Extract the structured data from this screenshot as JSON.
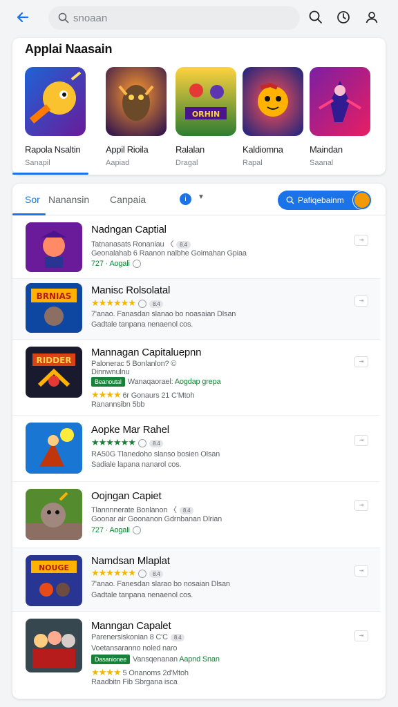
{
  "search": {
    "placeholder": "snoaan"
  },
  "featured": {
    "title": "Applai Naasain",
    "items": [
      {
        "name": "Rapola Nsaltin",
        "sub": "Sanapil"
      },
      {
        "name": "Appil Rioila",
        "sub": "Aapiad"
      },
      {
        "name": "Ralalan",
        "sub": "Dragal"
      },
      {
        "name": "Kaldiomna",
        "sub": "Rapal"
      },
      {
        "name": "Maindan",
        "sub": "Saanal"
      }
    ]
  },
  "tabs": {
    "items": [
      "Sor",
      "Nanansin",
      "Canpaia"
    ],
    "pill_label": "Pafiqebainm"
  },
  "list": [
    {
      "title": "Nadngan Captial",
      "l1": "Tatnanasats Ronaniau 〈",
      "badge": "8.4",
      "l2": "Geonalahab 6 Raanon nalbhe Goimahan Gpiaa",
      "l3": "727 · Aogali"
    },
    {
      "title": "Manisc Rolsolatal",
      "stars": "★★★★★★",
      "badge": "8.4",
      "l2": "7'anao.  Fanasdan slanao bo noasaian Dlsan",
      "l3": "Gadtale tanpana nenaenol cos."
    },
    {
      "title": "Mannagan Capitaluepnn",
      "l1": "Palonerac 5 Bonlanlon? ©",
      "l1b": "Dinnwnulnu",
      "gbadge": "Beanoutal",
      "gtext": "Wanaqaorael:",
      "gtext2": "Aogdap grepa",
      "stars": "★★★★",
      "l3": "6r Gonaurs 21 C'Mtoh",
      "l4": "Ranannsibn 5bb"
    },
    {
      "title": "Aopke Mar Rahel",
      "stars": "★★★★★★",
      "badge": "8.4",
      "l2": "RA50G  Tlanedoho slanso bosien Olsan",
      "l3": "Sadiale lapana nanarol cos."
    },
    {
      "title": "Oojngan Capiet",
      "l1": "Tlannnnerate Bonlanon 〈",
      "badge": "8.4",
      "l2": "Goonar air Goonanon Gdrnbanan Dlrian",
      "l3": "727 · Aogali"
    },
    {
      "title": "Namdsan Mlaplat",
      "stars": "★★★★★★",
      "badge": "8.4",
      "l2": "7'anao.  Fanesdan slarao bo nosaian Dlsan",
      "l3": "Gadtale tanpana nenaenol cos."
    },
    {
      "title": "Manngan Capalet",
      "l1": "Parenersiskonian 8 C'C",
      "badge": "8.4",
      "l1b": "Voetansaranno noled naro",
      "gbadge": "Dasanionee",
      "gtext": "Vansqenanan",
      "gtext2": "Aapnd Snan",
      "stars": "★★★★",
      "l3": "5 Onanoms 2d'Mtoh",
      "l4": "Raadbitn Fib Sbrgana isca"
    }
  ]
}
